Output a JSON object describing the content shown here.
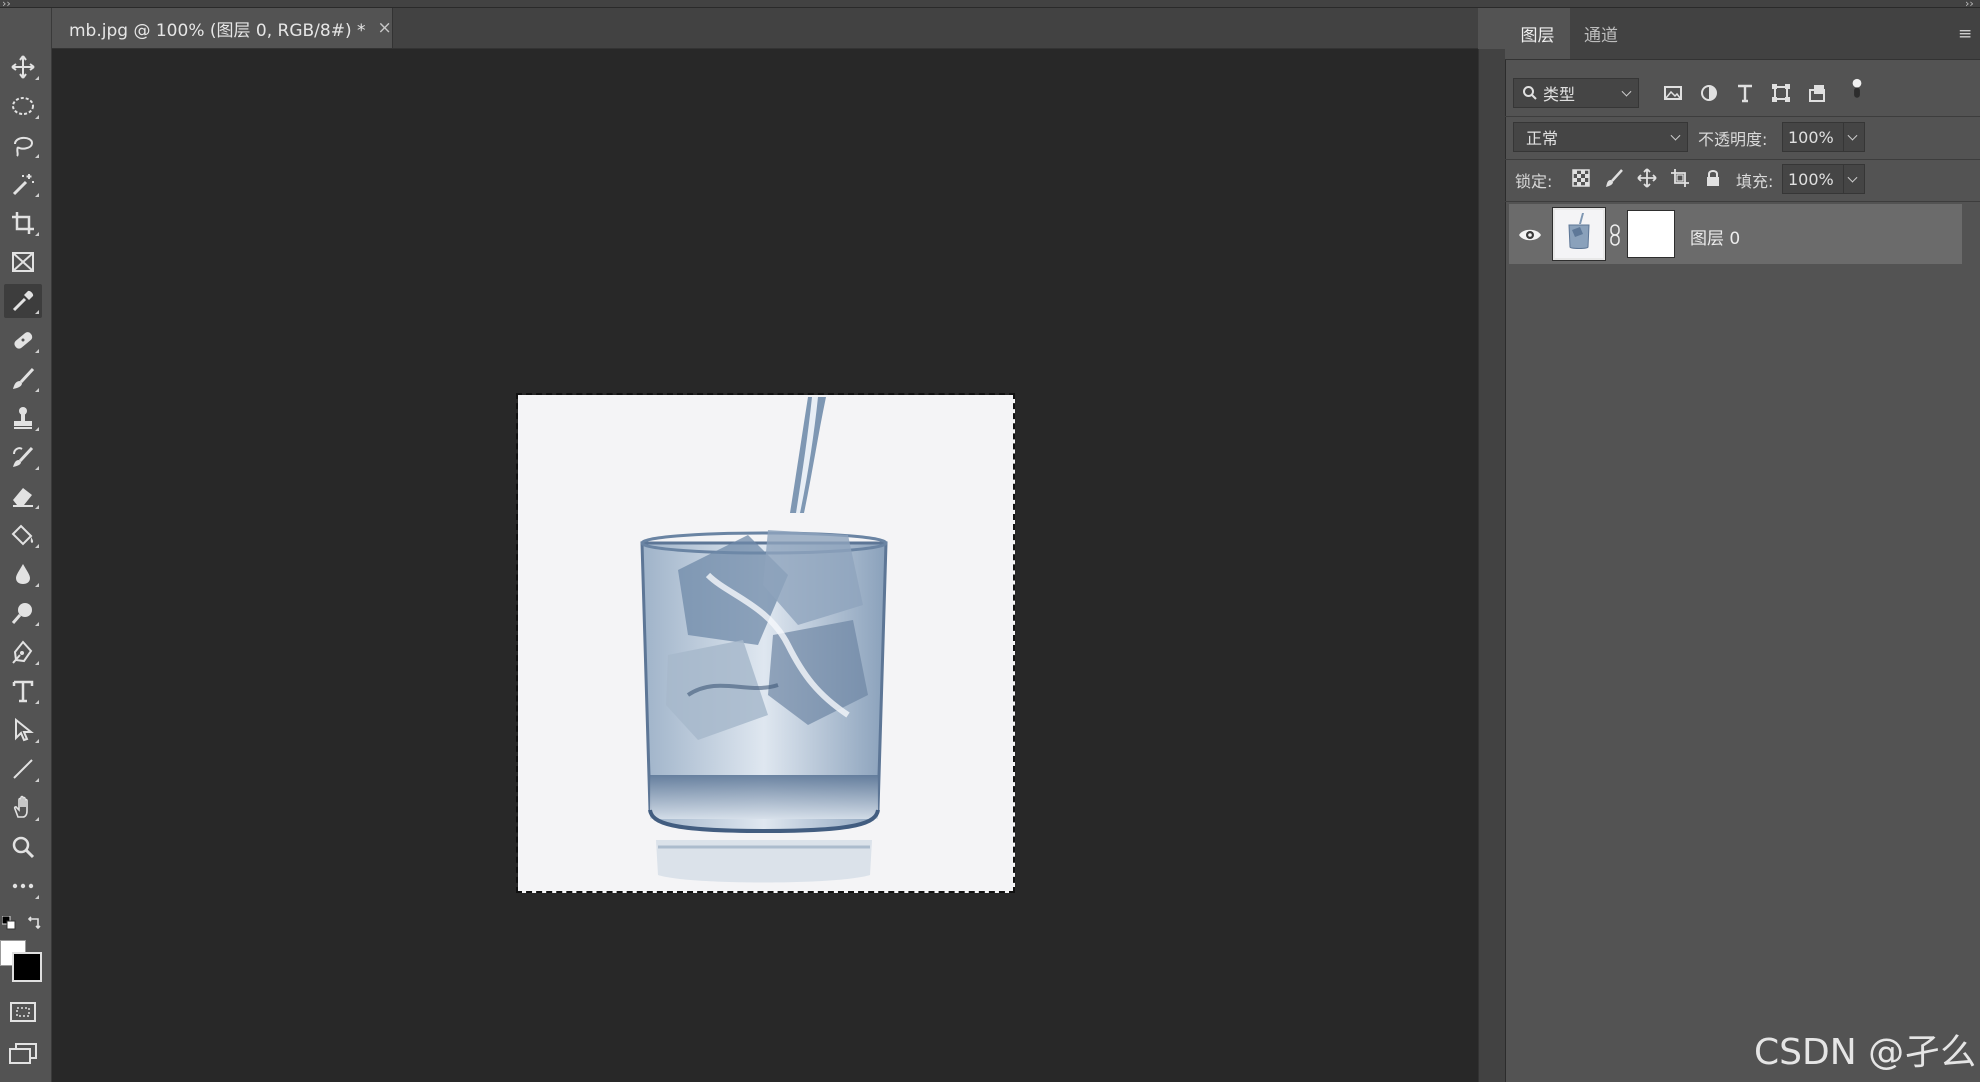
{
  "document_tab": {
    "title": "mb.jpg @ 100% (图层 0, RGB/8#) *",
    "close": "×"
  },
  "toolbar": {
    "tools": [
      "move-tool",
      "marquee-tool",
      "lasso-tool",
      "magic-wand-tool",
      "crop-tool",
      "frame-tool",
      "eyedropper-tool",
      "healing-brush-tool",
      "brush-tool",
      "clone-stamp-tool",
      "history-brush-tool",
      "eraser-tool",
      "paint-bucket-tool",
      "blur-tool",
      "dodge-tool",
      "pen-tool",
      "type-tool",
      "path-selection-tool",
      "line-tool",
      "hand-tool",
      "zoom-tool",
      "more-tools"
    ],
    "active_tool": "eyedropper-tool",
    "foreground_color": "#ffffff",
    "background_color": "#000000"
  },
  "panel": {
    "tabs": [
      "图层",
      "通道"
    ],
    "active_tab": "图层",
    "filter": {
      "label": "类型"
    },
    "blend_mode": "正常",
    "opacity_label": "不透明度:",
    "opacity_value": "100%",
    "lock_label": "锁定:",
    "fill_label": "填充:",
    "fill_value": "100%",
    "layers": [
      {
        "name": "图层 0",
        "visible": true
      }
    ]
  },
  "watermark": "CSDN @孑么",
  "colors": {
    "canvas": "#282828",
    "panel": "#535353",
    "document_bg": "#f4f4f6"
  }
}
